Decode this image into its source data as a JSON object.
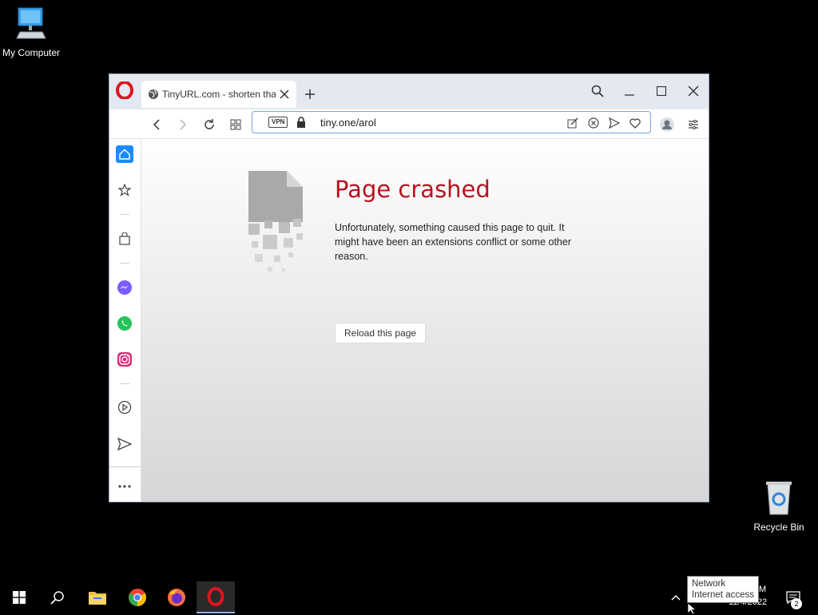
{
  "desktop": {
    "my_computer_label": "My Computer",
    "recycle_bin_label": "Recycle Bin"
  },
  "browser": {
    "tab": {
      "title": "TinyURL.com - shorten tha"
    },
    "address": {
      "vpn_badge": "VPN",
      "url": "tiny.one/arol"
    },
    "crash_page": {
      "title": "Page crashed",
      "message": "Unfortunately, something caused this page to quit. It might have been an extensions conflict or some other reason.",
      "reload_label": "Reload this page"
    },
    "sidebar_items": [
      "home-icon",
      "bookmarks-icon",
      "shopping-bag-icon",
      "messenger-icon",
      "whatsapp-icon",
      "instagram-icon",
      "player-icon",
      "send-icon",
      "more-icon"
    ]
  },
  "taskbar": {
    "apps": [
      "start",
      "search",
      "file-explorer",
      "chrome",
      "firefox",
      "opera"
    ],
    "clock_time_fragment": "M",
    "date": "11/4/2022",
    "notification_count": "2",
    "tooltip": {
      "line1": "Network",
      "line2": "Internet access"
    }
  },
  "colors": {
    "crash_title": "#b7131e",
    "accent": "#1a8cff"
  }
}
